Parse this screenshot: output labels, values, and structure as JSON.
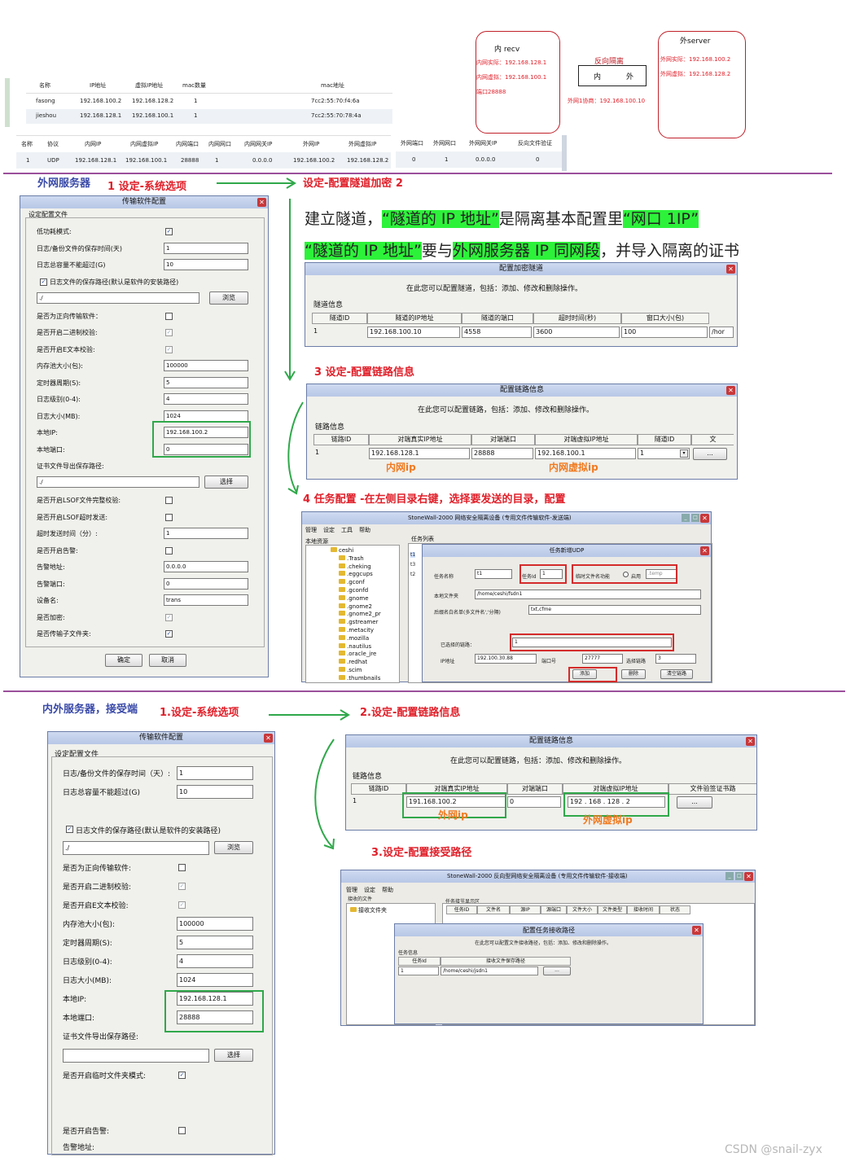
{
  "top": {
    "t1_headers": [
      "名称",
      "IP地址",
      "虚拟IP地址",
      "mac数量",
      "mac地址"
    ],
    "t1_rows": [
      [
        "fasong",
        "192.168.100.2",
        "192.168.128.2",
        "1",
        "7cc2:55:70:f4:6a"
      ],
      [
        "jieshou",
        "192.168.128.1",
        "192.168.100.1",
        "1",
        "7cc2:55:70:78:4a"
      ]
    ],
    "t2_headers": [
      "名称",
      "协议",
      "内网IP",
      "内网虚拟IP",
      "内网端口",
      "内网网口",
      "内网网关IP",
      "外网IP",
      "外网虚拟IP"
    ],
    "t2_row": [
      "1",
      "UDP",
      "192.168.128.1",
      "192.168.100.1",
      "28888",
      "1",
      "0.0.0.0",
      "192.168.100.2",
      "192.168.128.2"
    ],
    "t3_headers": [
      "外网端口",
      "外网网口",
      "外网网关IP",
      "反向文件验证"
    ],
    "t3_row": [
      "0",
      "1",
      "0.0.0.0",
      "0"
    ],
    "recv_title": "内 recv",
    "recv_lines": [
      "内网实际：192.168.128.1",
      "内网虚拟：192.168.100.1",
      "端口28888"
    ],
    "gap_title": "反向隔离",
    "gap_in": "内",
    "gap_out": "外",
    "gap_note": "外网1协商：192.168.100.10",
    "server_title": "外server",
    "server_lines": [
      "外网实际：192.168.100.2",
      "外网虚拟：192.168.128.2"
    ]
  },
  "sec1": {
    "label_main": "外网服务器",
    "label_step1": "1  设定-系统选项",
    "label_step2": "设定-配置隧道加密 2",
    "desc1_a": "建立隧道，",
    "desc1_b": "“隧道的 IP 地址”",
    "desc1_c": "是隔离基本配置里",
    "desc1_d": "“网口 1IP”",
    "desc2_a": "“隧道的 IP 地址”",
    "desc2_b": "要与",
    "desc2_c": "外网服务器 IP 同网段",
    "desc2_d": "，并导入隔离的证书",
    "dialog": {
      "title": "传输软件配置",
      "group": "设定配置文件",
      "rows": [
        {
          "label": "低功耗模式:",
          "type": "cb",
          "checked": "✓"
        },
        {
          "label": "日志/备份文件的保存时间(天)",
          "type": "field",
          "value": "1"
        },
        {
          "label": "日志总容量不能超过(G)",
          "type": "field",
          "value": "10"
        }
      ],
      "logpath_label": "日志文件的保存路径(默认是软件的安装路径)",
      "logpath_value": "./",
      "browse": "浏览",
      "rows2": [
        {
          "label": "是否为正向传输软件：",
          "type": "cb",
          "checked": ""
        },
        {
          "label": "是否开启二进制校验:",
          "type": "cbd",
          "checked": "✓"
        },
        {
          "label": "是否开启E文本校验:",
          "type": "cbd",
          "checked": "✓"
        },
        {
          "label": "内存池大小(包):",
          "type": "field",
          "value": "100000"
        },
        {
          "label": "定时器周期(S):",
          "type": "field",
          "value": "5"
        },
        {
          "label": "日志级别(0-4):",
          "type": "field",
          "value": "4"
        },
        {
          "label": "日志大小(MB):",
          "type": "field",
          "value": "1024"
        },
        {
          "label": "本地IP:",
          "type": "field",
          "value": "192.168.100.2"
        },
        {
          "label": "本地端口:",
          "type": "field",
          "value": "0"
        }
      ],
      "cert_label": "证书文件导出保存路径:",
      "cert_value": "./",
      "choose": "选择",
      "rows3": [
        {
          "label": "是否开启LSOF文件完整校验:",
          "type": "cb",
          "checked": ""
        },
        {
          "label": "是否开启LSOF超时发送:",
          "type": "cb",
          "checked": ""
        },
        {
          "label": "超时发送时间（分）:",
          "type": "field",
          "value": "1"
        },
        {
          "label": "是否开启告警:",
          "type": "cb",
          "checked": ""
        },
        {
          "label": "告警地址:",
          "type": "field",
          "value": "0.0.0.0"
        },
        {
          "label": "告警端口:",
          "type": "field",
          "value": "0"
        },
        {
          "label": "设备名:",
          "type": "field",
          "value": "trans"
        },
        {
          "label": "是否加密:",
          "type": "cbd",
          "checked": "✓"
        },
        {
          "label": "是否传输子文件夹:",
          "type": "cb",
          "checked": "✓"
        }
      ],
      "ok": "确定",
      "cancel": "取消"
    },
    "tunnel": {
      "title": "配置加密隧道",
      "desc": "在此您可以配置隧道，包括：添加、修改和删除操作。",
      "group": "隧道信息",
      "headers": [
        "隧道ID",
        "隧道的IP地址",
        "隧道的端口",
        "超时时间(秒)",
        "窗口大小(包)"
      ],
      "row": [
        "1",
        "192.168.100.10",
        "4558",
        "3600",
        "100",
        "/hor"
      ]
    },
    "step3": "3 设定-配置链路信息",
    "link": {
      "title": "配置链路信息",
      "desc": "在此您可以配置链路，包括：添加、修改和删除操作。",
      "group": "链路信息",
      "headers": [
        "链路ID",
        "对端真实IP地址",
        "对端端口",
        "对端虚拟IP地址",
        "隧道ID",
        "文"
      ],
      "row": [
        "1",
        "192.168.128.1",
        "28888",
        "192.168.100.1",
        "1",
        "..."
      ],
      "ann1": "内网ip",
      "ann2": "内网虚拟ip"
    },
    "step4": "4 任务配置 -在左侧目录右键，选择要发送的目录，配置",
    "app": {
      "title": "StoneWall-2000 网络安全隔离设备 (专用文件传输软件-发送端)",
      "menu": [
        "管理",
        "设定",
        "工具",
        "帮助"
      ],
      "local": "本地资源",
      "tasklist": "任务列表",
      "tree": [
        "ceshi",
        ".Trash",
        ".cheking",
        ".eggcups",
        ".gconf",
        ".gconfd",
        ".gnome",
        ".gnome2",
        ".gnome2_pr",
        ".gstreamer",
        ".metacity",
        ".mozilla",
        ".nautilus",
        ".oracle_jre",
        ".redhat",
        ".scim",
        ".thumbnails"
      ],
      "tasks": [
        "t1",
        "t3",
        "t2"
      ],
      "dlg_title": "任务新增UDP",
      "name_label": "任务名称",
      "name_value": "t1",
      "taskid_label": "任务Id",
      "taskid_value": "1",
      "temp_label": "临时文件名功能",
      "temp_opt": "启用",
      "temp_value": ".temp",
      "localdir_label": "本地文件夹",
      "localdir_value": "/home/ceshi/fsdn1",
      "suffix_label": "后缀名白名单(多文件名','分隔)",
      "suffix_value": "txt,cfme",
      "link_label": "已选择的链路：",
      "link_value": "1",
      "ip_label": "IP地址",
      "ip_value": "192.100.30.88",
      "port_label": "端口号",
      "port_value": "27777",
      "sel_label": "选择链路",
      "sel_value": "3",
      "add": "添加",
      "modify": "删除",
      "clear": "清空链路"
    }
  },
  "sec2": {
    "label_main": "内外服务器，接受端",
    "label_step1": "1.设定-系统选项",
    "label_step2": "2.设定-配置链路信息",
    "dialog": {
      "title": "传输软件配置",
      "group": "设定配置文件",
      "rows": [
        {
          "label": "日志/备份文件的保存时间（天）:",
          "value": "1"
        },
        {
          "label": "日志总容量不能超过(G)",
          "value": "10"
        }
      ],
      "logpath_label": "日志文件的保存路径(默认是软件的安装路径)",
      "logpath_value": "./",
      "browse": "浏览",
      "rows2": [
        {
          "label": "是否为正向传输软件:",
          "type": "cb",
          "checked": ""
        },
        {
          "label": "是否开启二进制校验:",
          "type": "cbd",
          "checked": "✓"
        },
        {
          "label": "是否开启E文本校验:",
          "type": "cbd",
          "checked": "✓"
        },
        {
          "label": "内存池大小(包):",
          "type": "field",
          "value": "100000"
        },
        {
          "label": "定时器周期(S):",
          "type": "field",
          "value": "5"
        },
        {
          "label": "日志级别(0-4):",
          "type": "field",
          "value": "4"
        },
        {
          "label": "日志大小(MB):",
          "type": "field",
          "value": "1024"
        },
        {
          "label": "本地IP:",
          "type": "field",
          "value": "192.168.128.1"
        },
        {
          "label": "本地端口:",
          "type": "field",
          "value": "28888"
        }
      ],
      "cert_label": "证书文件导出保存路径:",
      "cert_value": "",
      "choose": "选择",
      "temp_label": "是否开启临时文件夹模式:",
      "alarm_label": "是否开启告警:",
      "alarm_addr_label": "告警地址:"
    },
    "link": {
      "title": "配置链路信息",
      "desc": "在此您可以配置链路，包括：添加、修改和删除操作。",
      "group": "链路信息",
      "headers": [
        "链路ID",
        "对端真实IP地址",
        "对端端口",
        "对端虚拟IP地址",
        "文件验签证书路"
      ],
      "row": [
        "1",
        "191.168.100.2",
        "0",
        "192 . 168 . 128 . 2",
        "..."
      ],
      "ann1": "外网ip",
      "ann2": "外网虚拟ip"
    },
    "step3": "3.设定-配置接受路径",
    "recvapp": {
      "title": "StoneWall-2000 反向型网络安全隔离设备 (专用文件传输软件-接收端)",
      "menu": [
        "管理",
        "设定",
        "帮助"
      ],
      "recv_dir": "接收的文件",
      "recv_folder": "接收文件夹",
      "task_group": "任务接节显示区",
      "task_headers": [
        "任务ID",
        "文件名",
        "源IP",
        "源端口",
        "文件大小",
        "文件类型",
        "接收时间",
        "状态"
      ],
      "dlg_title": "配置任务接收路径",
      "dlg_desc": "在此您可以配置文件接收路径，包括：添加、修改和删除操作。",
      "dlg_group": "任务信息",
      "dlg_headers": [
        "任务Id",
        "接收文件保存路径"
      ],
      "dlg_row": [
        "1",
        "/home/ceshi/jsdn1",
        "..."
      ]
    }
  },
  "watermark": "CSDN @snail-zyx",
  "colors": {
    "divider": "#9b4f9b",
    "green": "#2fa84a",
    "red": "#d42b2b",
    "highlight": "#2df23a"
  }
}
